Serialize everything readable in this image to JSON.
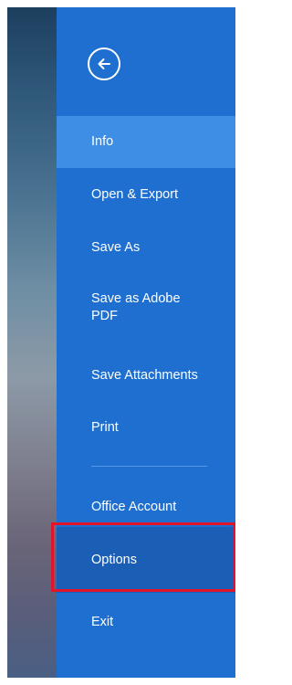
{
  "backstage": {
    "back_icon": "arrow-left-circle-icon",
    "items": [
      {
        "label": "Info",
        "active": true
      },
      {
        "label": "Open & Export"
      },
      {
        "label": "Save As"
      },
      {
        "label": "Save as Adobe PDF"
      },
      {
        "label": "Save Attachments"
      },
      {
        "label": "Print"
      },
      {
        "label": "Office Account"
      },
      {
        "label": "Options",
        "highlighted": true
      },
      {
        "label": "Exit"
      }
    ]
  },
  "colors": {
    "backstage_bg": "#1e6fd0",
    "active_item_bg": "#3e8ee6",
    "highlight_border": "#e0142c"
  }
}
